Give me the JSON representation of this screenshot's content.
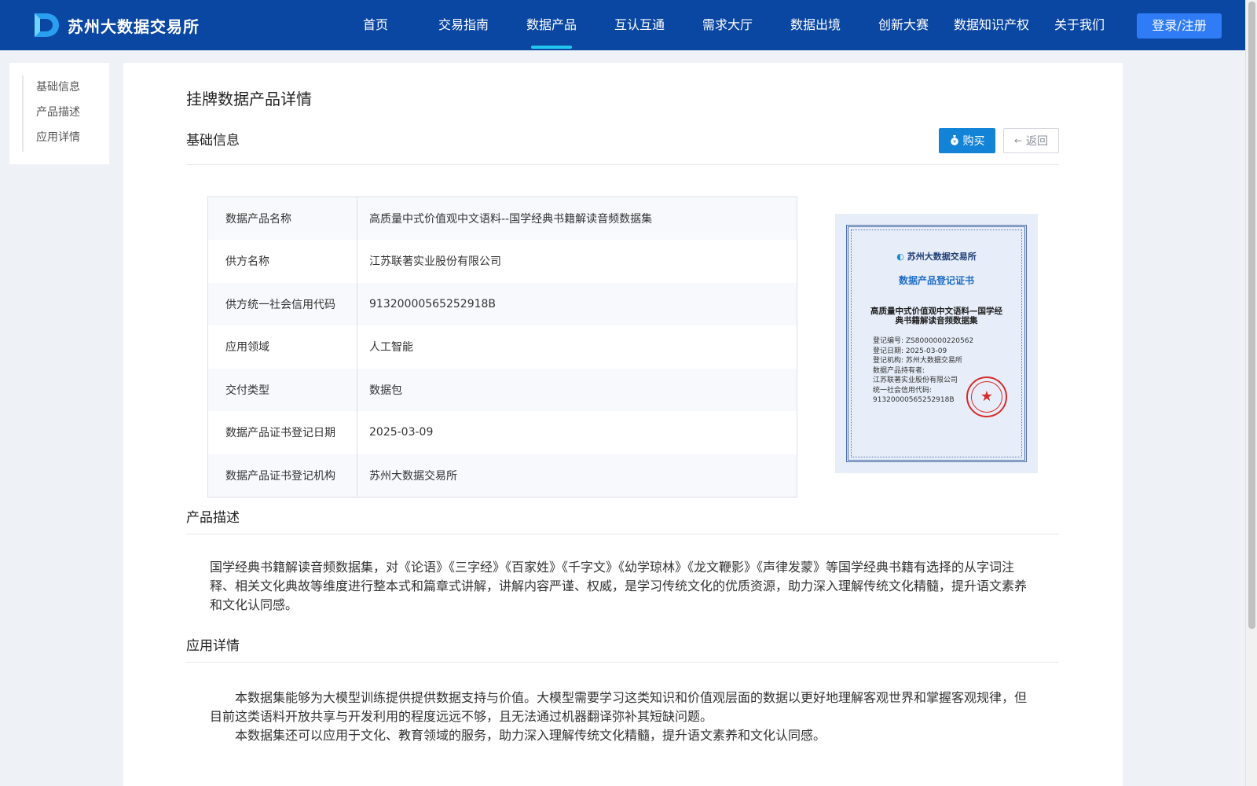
{
  "header": {
    "brand": "苏州大数据交易所",
    "nav": [
      "首页",
      "交易指南",
      "数据产品",
      "互认互通",
      "需求大厅",
      "数据出境",
      "创新大赛",
      "数据知识产权",
      "关于我们"
    ],
    "active_nav": "数据产品",
    "login_label": "登录/注册"
  },
  "sidenav": {
    "items": [
      "基础信息",
      "产品描述",
      "应用详情"
    ]
  },
  "page": {
    "title": "挂牌数据产品详情",
    "basic_section": "基础信息",
    "buy_label": "购买",
    "back_label": "返回",
    "info_rows": [
      {
        "label": "数据产品名称",
        "value": "高质量中式价值观中文语料--国学经典书籍解读音频数据集"
      },
      {
        "label": "供方名称",
        "value": "江苏联著实业股份有限公司"
      },
      {
        "label": "供方统一社会信用代码",
        "value": "91320000565252918B"
      },
      {
        "label": "应用领域",
        "value": "人工智能"
      },
      {
        "label": "交付类型",
        "value": "数据包"
      },
      {
        "label": "数据产品证书登记日期",
        "value": "2025-03-09"
      },
      {
        "label": "数据产品证书登记机构",
        "value": "苏州大数据交易所"
      }
    ],
    "certificate": {
      "org": "苏州大数据交易所",
      "title": "数据产品登记证书",
      "product": "高质量中式价值观中文语料—国学经典书籍解读音频数据集",
      "lines": [
        "登记编号: ZS8000000220562",
        "登记日期: 2025-03-09",
        "登记机构: 苏州大数据交易所",
        "数据产品持有者:",
        "江苏联著实业股份有限公司",
        "统一社会信用代码:",
        "91320000565252918B"
      ]
    },
    "desc_section": "产品描述",
    "desc_text": "国学经典书籍解读音频数据集，对《论语》《三字经》《百家姓》《千字文》《幼学琼林》《龙文鞭影》《声律发蒙》等国学经典书籍有选择的从字词注释、相关文化典故等维度进行整本式和篇章式讲解，讲解内容严谨、权威，是学习传统文化的优质资源，助力深入理解传统文化精髓，提升语文素养和文化认同感。",
    "app_section": "应用详情",
    "app_paragraphs": [
      "本数据集能够为大模型训练提供提供数据支持与价值。大模型需要学习这类知识和价值观层面的数据以更好地理解客观世界和掌握客观规律，但目前这类语料开放共享与开发利用的程度远远不够，且无法通过机器翻译弥补其短缺问题。",
      "本数据集还可以应用于文化、教育领域的服务，助力深入理解传统文化精髓，提升语文素养和文化认同感。"
    ]
  },
  "colors": {
    "header_bg": "#0a47a3",
    "nav_indicator": "#22c7f0",
    "login_btn": "#2f7cf6",
    "buy_btn": "#1283d6",
    "seal": "#d62b2b"
  }
}
